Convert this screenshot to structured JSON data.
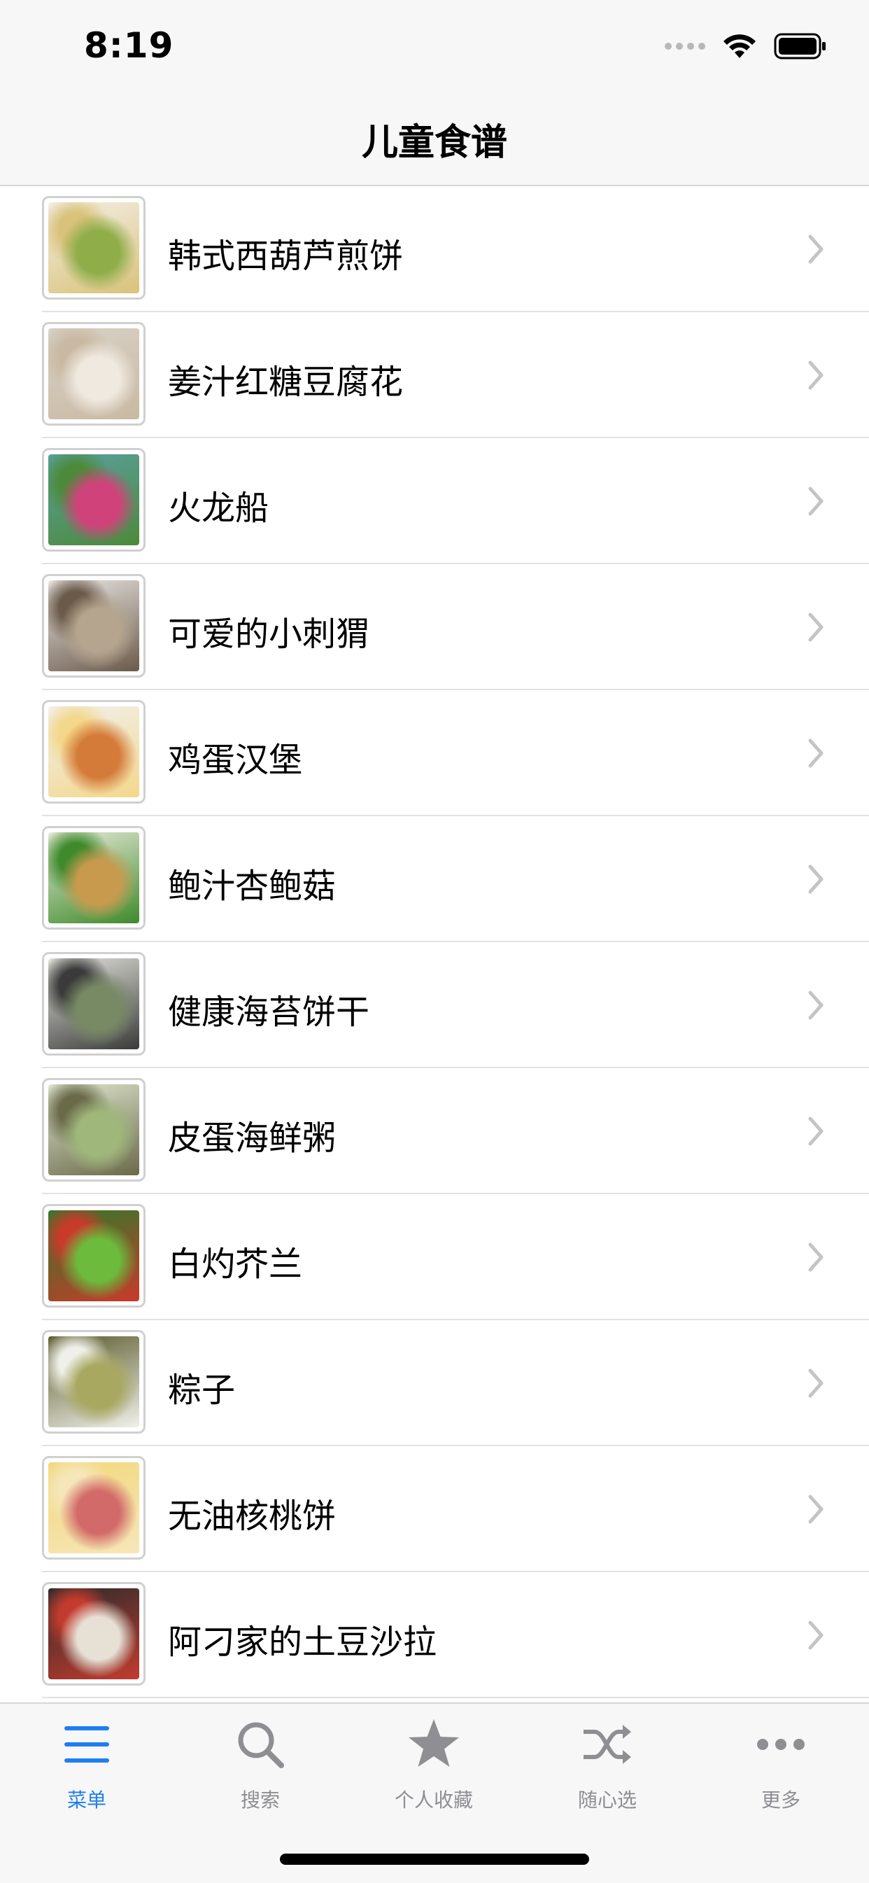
{
  "status": {
    "time": "8:19"
  },
  "nav": {
    "title": "儿童食谱"
  },
  "list": [
    {
      "title": "韩式西葫芦煎饼",
      "thumb_colors": [
        "#f4efe6",
        "#8fae4a",
        "#d9c27a"
      ]
    },
    {
      "title": "姜汁红糖豆腐花",
      "thumb_colors": [
        "#d8d2c8",
        "#efe9e0",
        "#c9b9a2"
      ]
    },
    {
      "title": "火龙船",
      "thumb_colors": [
        "#5aa0a0",
        "#d0437a",
        "#4c8a3a"
      ]
    },
    {
      "title": "可爱的小刺猬",
      "thumb_colors": [
        "#e9e6e3",
        "#b5a58e",
        "#6b5a4a"
      ]
    },
    {
      "title": "鸡蛋汉堡",
      "thumb_colors": [
        "#f1f1f1",
        "#d57b3a",
        "#f3d78a"
      ]
    },
    {
      "title": "鲍汁杏鲍菇",
      "thumb_colors": [
        "#e7ead8",
        "#c89a4e",
        "#3f8a2c"
      ]
    },
    {
      "title": "健康海苔饼干",
      "thumb_colors": [
        "#e4e4dd",
        "#778a64",
        "#3a3a3a"
      ]
    },
    {
      "title": "皮蛋海鲜粥",
      "thumb_colors": [
        "#dfe6cf",
        "#9fb77a",
        "#6a6a4a"
      ]
    },
    {
      "title": "白灼芥兰",
      "thumb_colors": [
        "#2f7a2a",
        "#6cbb3c",
        "#c83a2a"
      ]
    },
    {
      "title": "粽子",
      "thumb_colors": [
        "#5a5a2a",
        "#a8a860",
        "#f0f0ea"
      ]
    },
    {
      "title": "无油核桃饼",
      "thumb_colors": [
        "#f2d77a",
        "#d26a6a",
        "#f6e7b9"
      ]
    },
    {
      "title": "阿刁家的土豆沙拉",
      "thumb_colors": [
        "#2b2b2b",
        "#e7e1d5",
        "#c23b2e"
      ]
    }
  ],
  "tabs": [
    {
      "label": "菜单",
      "icon": "menu-icon",
      "active": true
    },
    {
      "label": "搜索",
      "icon": "search-icon",
      "active": false
    },
    {
      "label": "个人收藏",
      "icon": "star-icon",
      "active": false
    },
    {
      "label": "随心选",
      "icon": "shuffle-icon",
      "active": false
    },
    {
      "label": "更多",
      "icon": "more-icon",
      "active": false
    }
  ],
  "colors": {
    "accent": "#1e7ef1",
    "tab_inactive": "#8e8e93",
    "chevron": "#c4c4c7"
  }
}
